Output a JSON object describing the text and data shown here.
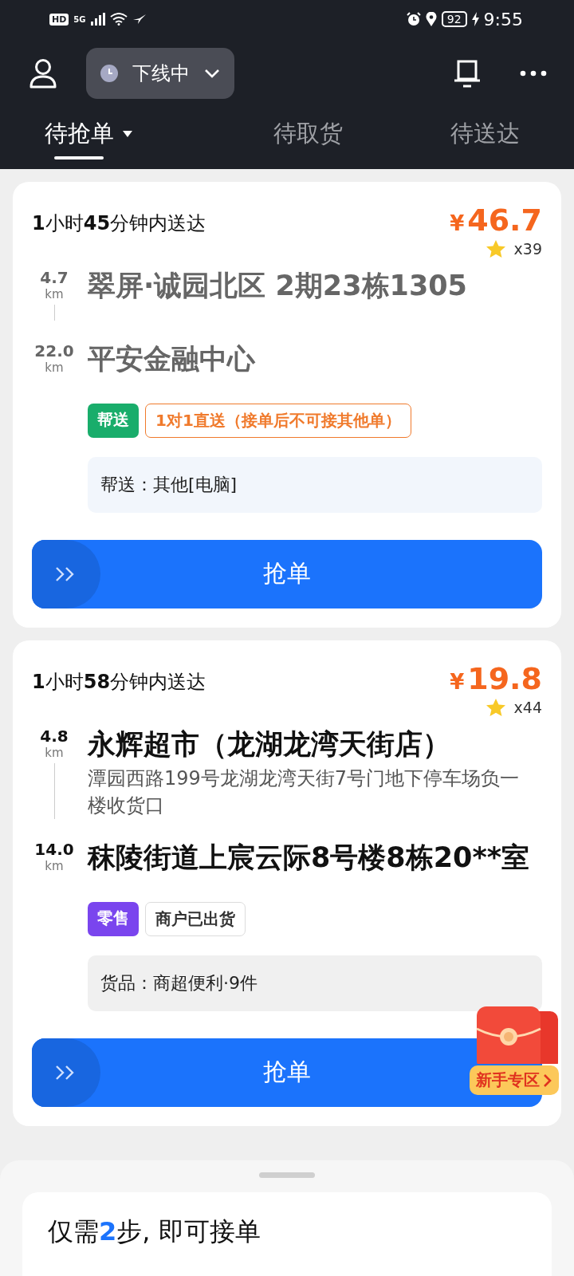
{
  "status_bar": {
    "hd": "HD",
    "network": "5G",
    "battery": "92",
    "time": "9:55"
  },
  "header": {
    "status": "下线中"
  },
  "tabs": [
    {
      "label": "待抢单",
      "selected": true,
      "dropdown": true
    },
    {
      "label": "待取货",
      "selected": false,
      "dropdown": false
    },
    {
      "label": "待送达",
      "selected": false,
      "dropdown": false
    }
  ],
  "orders": [
    {
      "deadline": "**1**小时**45**分钟内送达",
      "price_symbol": "¥",
      "price": "46.7",
      "reward": "x39",
      "dimmed": true,
      "stops": [
        {
          "distance": "4.7",
          "unit": "km",
          "address": "翠屏·诚园北区 2期23栋1305"
        },
        {
          "distance": "22.0",
          "unit": "km",
          "address": "平安金融中心"
        }
      ],
      "tags": [
        {
          "kind": "solid",
          "label": "帮送",
          "color": "#19ad6b"
        },
        {
          "kind": "outline",
          "label": "1对1直送（接单后不可接其他单）",
          "color": "#f07a2c"
        }
      ],
      "note": "帮送：其他[电脑]",
      "action": "抢单"
    },
    {
      "deadline": "**1**小时**58**分钟内送达",
      "price_symbol": "¥",
      "price": "19.8",
      "reward": "x44",
      "dimmed": false,
      "stops": [
        {
          "distance": "4.8",
          "unit": "km",
          "address": "永辉超市（龙湖龙湾天街店）",
          "detail": "潭园西路199号龙湖龙湾天街7号门地下停车场负一楼收货口"
        },
        {
          "distance": "14.0",
          "unit": "km",
          "address": "秣陵街道上宸云际8号楼8栋20**室"
        }
      ],
      "tags": [
        {
          "kind": "solid",
          "label": "零售",
          "color": "#7a45ee"
        },
        {
          "kind": "outline",
          "label": "商户已出货",
          "color": "#dcdcdc"
        }
      ],
      "note": "货品：商超便利·9件",
      "action": "抢单"
    }
  ],
  "promo": {
    "label": "新手专区"
  },
  "bottom_sheet": {
    "title_before": "仅需",
    "title_highlight": "2",
    "title_after": "步, 即可接单"
  }
}
